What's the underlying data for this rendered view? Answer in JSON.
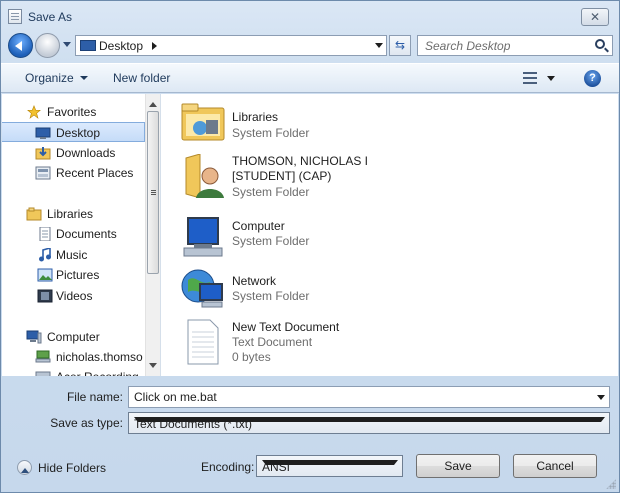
{
  "window": {
    "title": "Save As",
    "close_glyph": "✕"
  },
  "address": {
    "location": "Desktop",
    "refresh_glyph": "⇆",
    "search_placeholder": "Search Desktop"
  },
  "toolbar": {
    "organize": "Organize",
    "new_folder": "New folder",
    "help_glyph": "?"
  },
  "nav": {
    "favorites": "Favorites",
    "desktop": "Desktop",
    "downloads": "Downloads",
    "recent_places": "Recent Places",
    "libraries": "Libraries",
    "documents": "Documents",
    "music": "Music",
    "pictures": "Pictures",
    "videos": "Videos",
    "computer": "Computer",
    "user_drive": "nicholas.thomso",
    "cut_off": "Acer Recording"
  },
  "content": {
    "items": [
      {
        "name": "Libraries",
        "type": "System Folder",
        "icon": "libraries-folder-icon"
      },
      {
        "name": "THOMSON, NICHOLAS I [STUDENT] (CAP)",
        "type": "System Folder",
        "icon": "user-folder-icon"
      },
      {
        "name": "Computer",
        "type": "System Folder",
        "icon": "computer-icon"
      },
      {
        "name": "Network",
        "type": "System Folder",
        "icon": "network-icon"
      },
      {
        "name": "New Text Document",
        "type": "Text Document",
        "size": "0 bytes",
        "icon": "text-document-icon"
      }
    ]
  },
  "form": {
    "file_name_label": "File name:",
    "file_name_value": "Click on me.bat",
    "save_type_label": "Save as type:",
    "save_type_value": "Text Documents (*.txt)",
    "hide_folders": "Hide Folders",
    "encoding_label": "Encoding:",
    "encoding_value": "ANSI",
    "save_button": "Save",
    "cancel_button": "Cancel"
  },
  "colors": {
    "accent": "#1e395b",
    "selection": "#c5dcf8",
    "folder": "#f0c75a"
  }
}
